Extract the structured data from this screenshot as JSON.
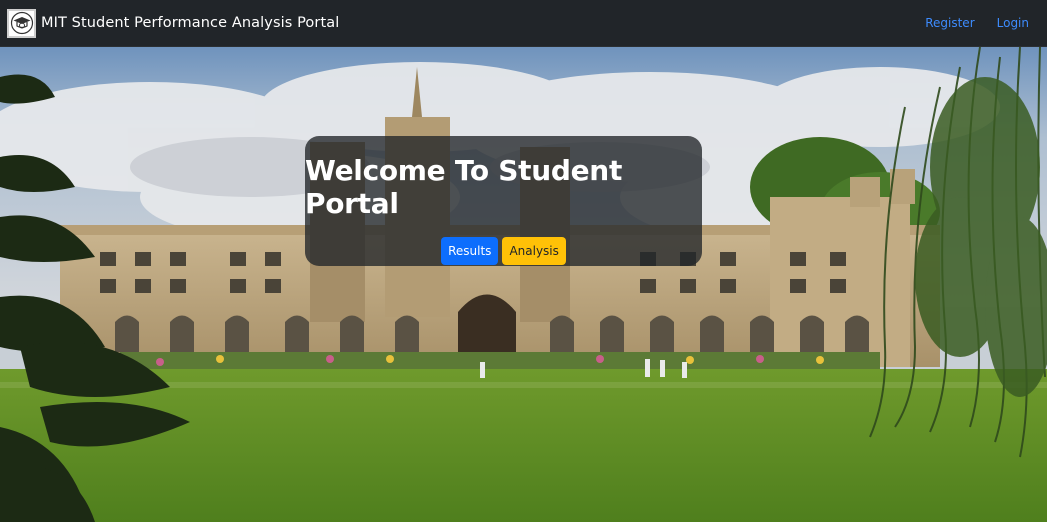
{
  "navbar": {
    "brand_title": "MIT Student Performance Analysis Portal",
    "links": [
      "Register",
      "Login"
    ]
  },
  "hero": {
    "title": "Welcome To Student Portal",
    "buttons": [
      "Results",
      "Analysis"
    ]
  },
  "colors": {
    "navbar_bg": "#212529",
    "link": "#3d8bfd",
    "primary": "#0d6efd",
    "warning": "#ffc107"
  },
  "icons": {
    "brand": "graduate-cap-icon"
  }
}
